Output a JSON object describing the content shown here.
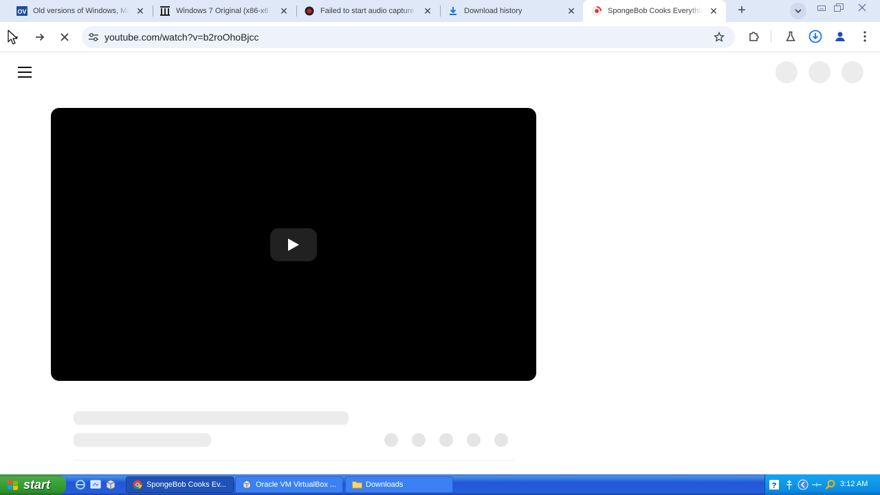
{
  "tabs": [
    {
      "title": "Old versions of Windows, Ma",
      "favicon": "oldversion-icon",
      "active": false
    },
    {
      "title": "Windows 7 Original (x86-x6",
      "favicon": "archive-icon",
      "active": false
    },
    {
      "title": "Failed to start audio capture",
      "favicon": "record-icon",
      "active": false
    },
    {
      "title": "Download history",
      "favicon": "download-icon",
      "active": false
    },
    {
      "title": "SpongeBob Cooks Everythin",
      "favicon": "youtube-icon",
      "active": true
    }
  ],
  "favicons": {
    "oldversion": "OV"
  },
  "toolbar": {
    "url": "youtube.com/watch?v=b2roOhoBjcc"
  },
  "colors": {
    "tabstrip": "#dfe8f7",
    "omnibox": "#eef2fa",
    "download_accent": "#1a73e8",
    "record": "#c5221f",
    "xp_taskbar": "#245edb",
    "xp_start": "#36a036",
    "xp_tray": "#0c8be0"
  },
  "taskbar": {
    "start_label": "start",
    "tasks": [
      {
        "label": "SpongeBob Cooks Ev...",
        "icon": "chrome-icon",
        "active": true
      },
      {
        "label": "Oracle VM VirtualBox ...",
        "icon": "virtualbox-icon",
        "active": false
      },
      {
        "label": "Downloads",
        "icon": "folder-icon",
        "active": false
      }
    ],
    "clock": "3:12 AM"
  }
}
